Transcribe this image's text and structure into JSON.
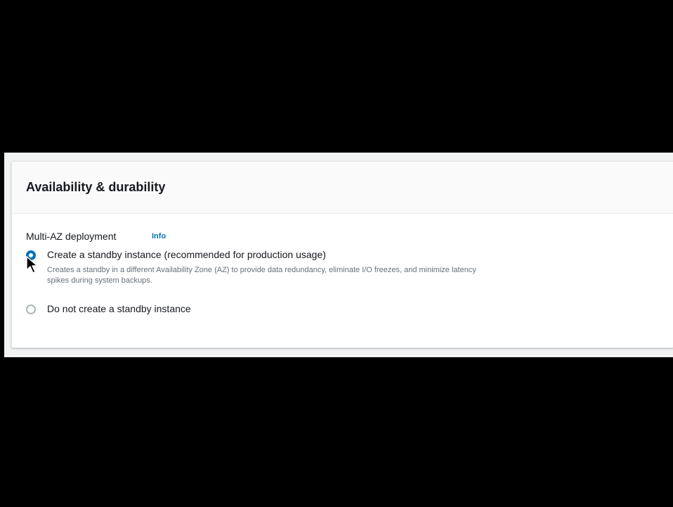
{
  "section": {
    "title": "Availability & durability"
  },
  "multi_az": {
    "label": "Multi-AZ deployment",
    "info_link": "Info",
    "selected_option": "Create a standby instance (recommended for production usage)",
    "options": [
      {
        "label": "Create a standby instance (recommended for production usage)",
        "description": "Creates a standby in a different Availability Zone (AZ) to provide data redundancy, eliminate I/O freezes, and minimize latency spikes during system backups.",
        "checked": true
      },
      {
        "label": "Do not create a standby instance",
        "checked": false
      }
    ]
  },
  "colors": {
    "accent": "#0073bb",
    "letterbox": "#000000",
    "panel_bg": "#ffffff",
    "header_bg": "#fafafa"
  },
  "icons": [
    "mouse-pointer-icon"
  ]
}
